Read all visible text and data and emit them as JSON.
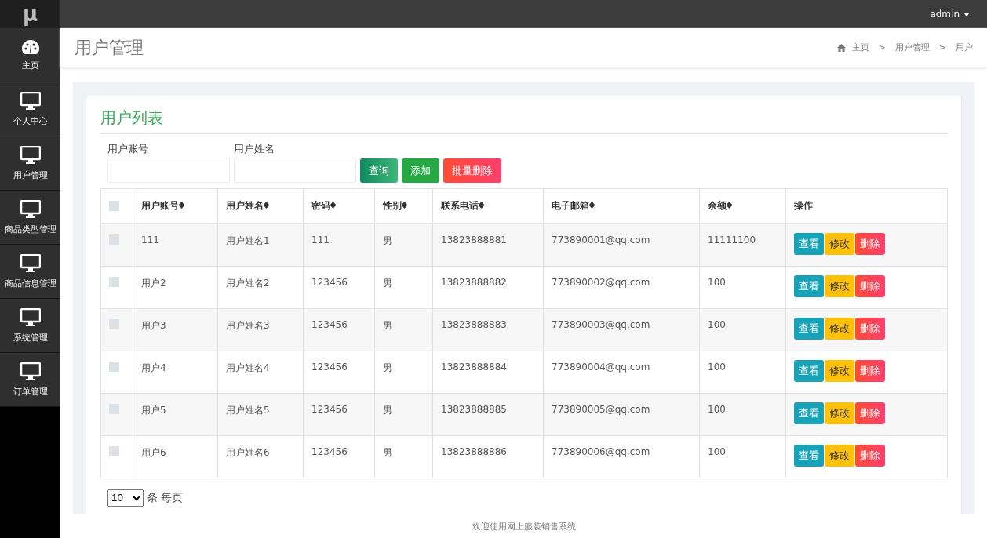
{
  "topbar": {
    "logo": "μ",
    "user": "admin"
  },
  "sidebar": {
    "items": [
      {
        "label": "主页",
        "kind": "dashboard"
      },
      {
        "label": "个人中心",
        "kind": "monitor"
      },
      {
        "label": "用户管理",
        "kind": "monitor"
      },
      {
        "label": "商品类型管理",
        "kind": "monitor"
      },
      {
        "label": "商品信息管理",
        "kind": "monitor"
      },
      {
        "label": "系统管理",
        "kind": "monitor"
      },
      {
        "label": "订单管理",
        "kind": "monitor"
      }
    ]
  },
  "header": {
    "title": "用户管理",
    "breadcrumb": [
      "主页",
      "用户管理",
      "用户"
    ],
    "separator": ">"
  },
  "card": {
    "title": "用户列表",
    "filters": [
      {
        "label": "用户账号"
      },
      {
        "label": "用户姓名"
      }
    ],
    "buttons": [
      {
        "label": "查询",
        "kind": "search"
      },
      {
        "label": "添加",
        "kind": "add"
      },
      {
        "label": "批量删除",
        "kind": "delete"
      }
    ],
    "table": {
      "select_all_checked": false,
      "columns": [
        "用户账号",
        "用户姓名",
        "密码",
        "性别",
        "联系电话",
        "电子邮箱",
        "余额",
        "操作"
      ],
      "rows": [
        {
          "checked": false,
          "cells": [
            "111",
            "用户姓名1",
            "111",
            "男",
            "13823888881",
            "773890001@qq.com",
            "11111100"
          ],
          "actions": [
            {
              "label": "查看",
              "kind": "view"
            },
            {
              "label": "修改",
              "kind": "edit"
            },
            {
              "label": "删除",
              "kind": "delete"
            }
          ]
        },
        {
          "checked": false,
          "cells": [
            "用户2",
            "用户姓名2",
            "123456",
            "男",
            "13823888882",
            "773890002@qq.com",
            "100"
          ],
          "actions": [
            {
              "label": "查看",
              "kind": "view"
            },
            {
              "label": "修改",
              "kind": "edit"
            },
            {
              "label": "删除",
              "kind": "delete"
            }
          ]
        },
        {
          "checked": false,
          "cells": [
            "用户3",
            "用户姓名3",
            "123456",
            "男",
            "13823888883",
            "773890003@qq.com",
            "100"
          ],
          "actions": [
            {
              "label": "查看",
              "kind": "view"
            },
            {
              "label": "修改",
              "kind": "edit"
            },
            {
              "label": "删除",
              "kind": "delete"
            }
          ]
        },
        {
          "checked": false,
          "cells": [
            "用户4",
            "用户姓名4",
            "123456",
            "男",
            "13823888884",
            "773890004@qq.com",
            "100"
          ],
          "actions": [
            {
              "label": "查看",
              "kind": "view"
            },
            {
              "label": "修改",
              "kind": "edit"
            },
            {
              "label": "删除",
              "kind": "delete"
            }
          ]
        },
        {
          "checked": false,
          "cells": [
            "用户5",
            "用户姓名5",
            "123456",
            "男",
            "13823888885",
            "773890005@qq.com",
            "100"
          ],
          "actions": [
            {
              "label": "查看",
              "kind": "view"
            },
            {
              "label": "修改",
              "kind": "edit"
            },
            {
              "label": "删除",
              "kind": "delete"
            }
          ]
        },
        {
          "checked": false,
          "cells": [
            "用户6",
            "用户姓名6",
            "123456",
            "男",
            "13823888886",
            "773890006@qq.com",
            "100"
          ],
          "actions": [
            {
              "label": "查看",
              "kind": "view"
            },
            {
              "label": "修改",
              "kind": "edit"
            },
            {
              "label": "删除",
              "kind": "delete"
            }
          ]
        }
      ]
    },
    "pagination": {
      "page_size": "10",
      "text": "条 每页"
    }
  },
  "footer": "欢迎使用网上服装销售系统"
}
